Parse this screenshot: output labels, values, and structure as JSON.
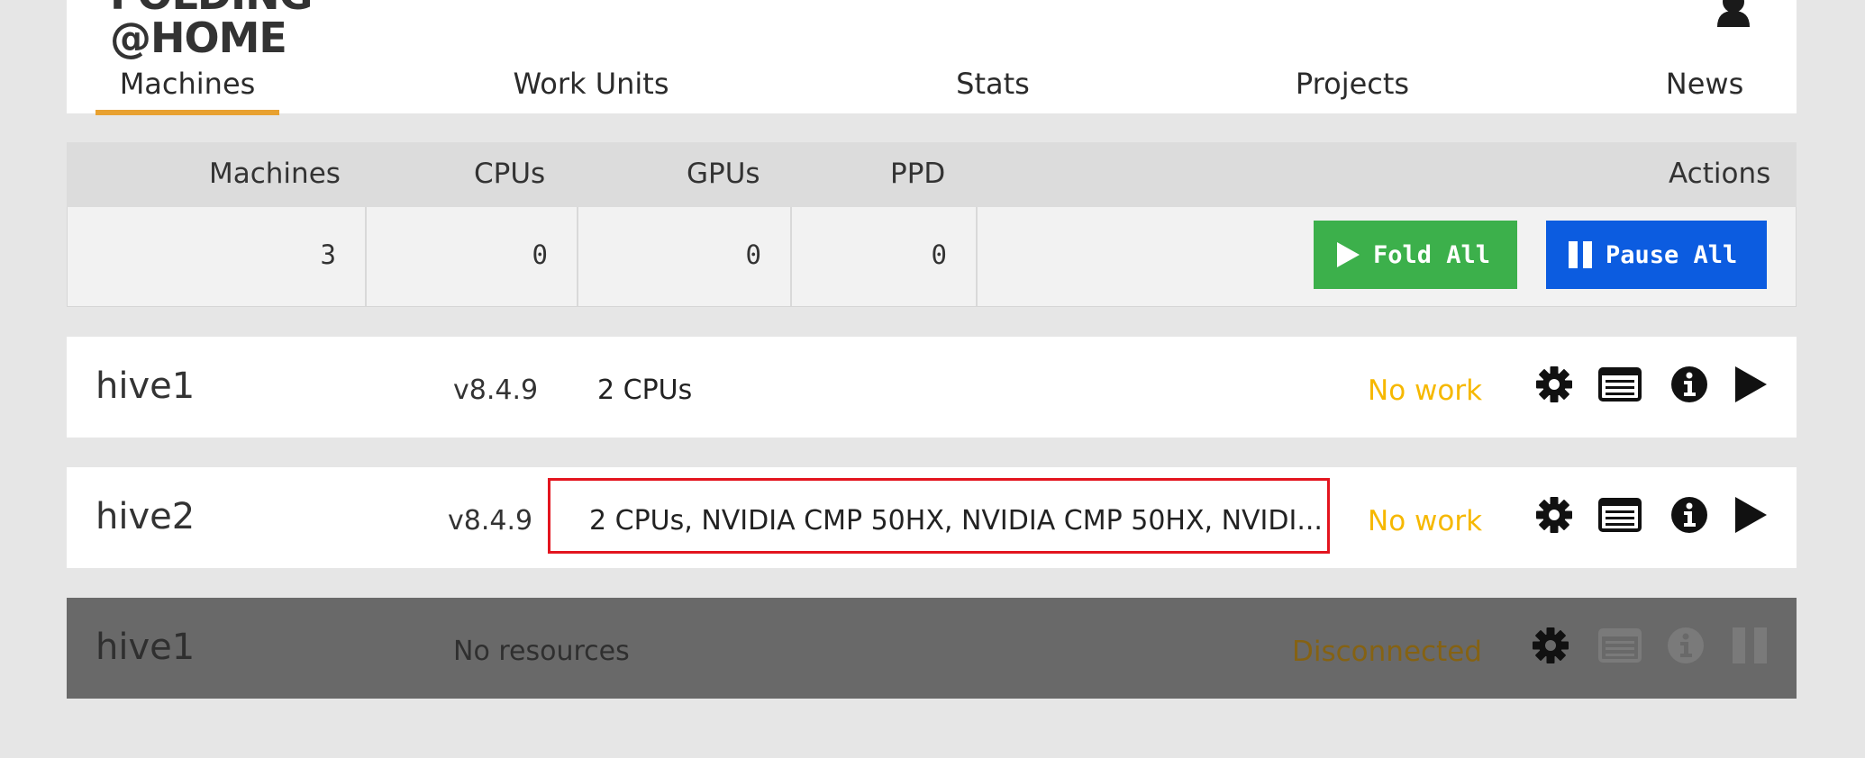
{
  "header": {
    "logo_top": "FOLDING",
    "logo_bottom": "@HOME",
    "user_icon": "user-icon"
  },
  "nav": {
    "tabs": [
      {
        "label": "Machines",
        "active": true
      },
      {
        "label": "Work Units"
      },
      {
        "label": "Stats"
      },
      {
        "label": "Projects"
      },
      {
        "label": "News"
      }
    ]
  },
  "summary": {
    "headers": {
      "machines": "Machines",
      "cpus": "CPUs",
      "gpus": "GPUs",
      "ppd": "PPD",
      "actions": "Actions"
    },
    "values": {
      "machines": "3",
      "cpus": "0",
      "gpus": "0",
      "ppd": "0"
    },
    "fold_all_label": "Fold All",
    "pause_all_label": "Pause All",
    "colors": {
      "fold": "#3cb04b",
      "pause": "#0c5ce0"
    }
  },
  "machines": [
    {
      "name": "hive1",
      "version": "v8.4.9",
      "resources": "2 CPUs",
      "status": "No work",
      "state": "connected"
    },
    {
      "name": "hive2",
      "version": "v8.4.9",
      "resources": "2 CPUs, NVIDIA CMP 50HX, NVIDIA CMP 50HX, NVIDI...",
      "status": "No work",
      "state": "connected"
    },
    {
      "name": "hive1",
      "version": "",
      "resources": "No resources",
      "status": "Disconnected",
      "state": "disconnected"
    }
  ],
  "colors": {
    "accent": "#e8a130",
    "status_warn": "#f6b800",
    "highlight": "#e3151f"
  }
}
